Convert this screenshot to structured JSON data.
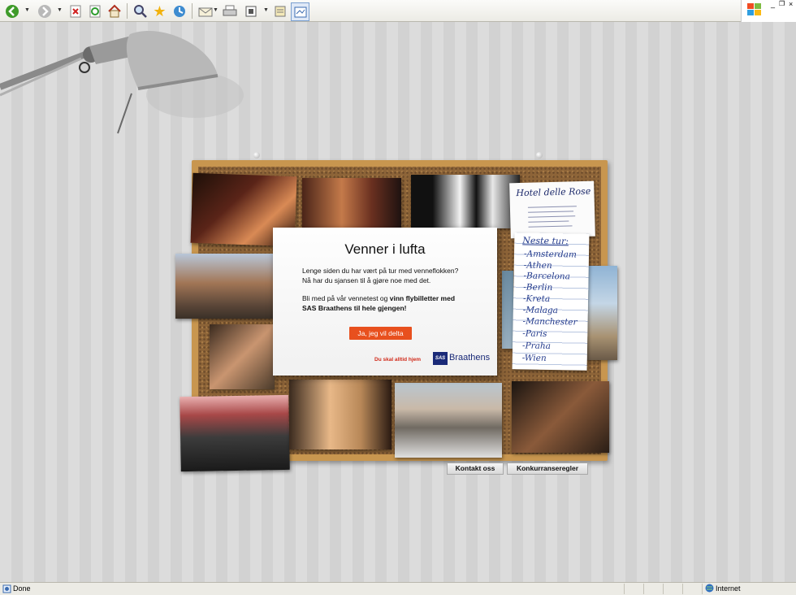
{
  "toolbar": {
    "buttons": [
      "back-icon",
      "forward-icon",
      "stop-icon",
      "refresh-icon",
      "home-icon",
      "search-icon",
      "favorites-icon",
      "history-icon",
      "mail-icon",
      "print-icon",
      "edit-icon",
      "discuss-icon",
      "messenger-icon"
    ]
  },
  "colors": {
    "cta": "#e8501e",
    "sas_blue": "#1a2a78",
    "cork": "#8d6438",
    "frame": "#c8964f",
    "tagline": "#d12a1a",
    "note_ink": "#233a8c"
  },
  "hotel_card": {
    "title": "Hotel delle Rose"
  },
  "notepad": {
    "title": "Neste tur:",
    "destinations": [
      "-Amsterdam",
      "-Athen",
      "-Barcelona",
      "-Berlin",
      "-Kreta",
      "-Malaga",
      "-Manchester",
      "-Paris",
      "-Praha",
      "-Wien"
    ]
  },
  "card": {
    "title": "Venner i lufta",
    "para1_line1": "Lenge siden du har vært på tur med venneflokken?",
    "para1_line2": "Nå har du sjansen til å gjøre noe med det.",
    "para2_pre": "Bli med på vår vennetest og ",
    "para2_bold1": "vinn flybilletter med",
    "para2_bold2": "SAS Braathens til hele gjengen!",
    "cta": "Ja, jeg vil delta",
    "tagline": "Du skal alltid hjem",
    "logo_sas": "SAS",
    "logo_braathens": "Braathens"
  },
  "footer": {
    "contact": "Kontakt oss",
    "rules": "Konkurranseregler"
  },
  "statusbar": {
    "status": "Done",
    "zone": "Internet"
  }
}
